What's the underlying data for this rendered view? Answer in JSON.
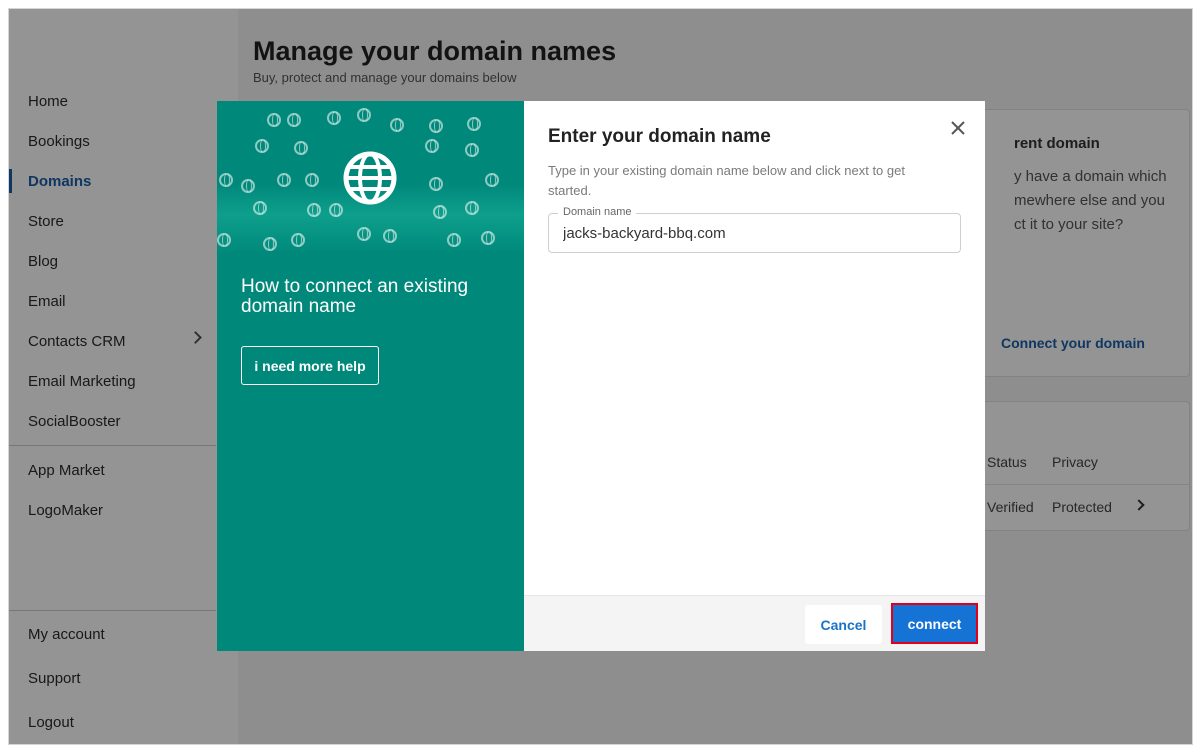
{
  "sidebar": {
    "items": [
      {
        "label": "Home"
      },
      {
        "label": "Bookings"
      },
      {
        "label": "Domains"
      },
      {
        "label": "Store"
      },
      {
        "label": "Blog"
      },
      {
        "label": "Email"
      },
      {
        "label": "Contacts CRM"
      },
      {
        "label": "Email Marketing"
      },
      {
        "label": "SocialBooster"
      },
      {
        "label": "App Market"
      },
      {
        "label": "LogoMaker"
      }
    ],
    "bottom_items": [
      {
        "label": "My account"
      },
      {
        "label": "Support"
      },
      {
        "label": "Logout"
      }
    ],
    "active": "Domains"
  },
  "main": {
    "title": "Manage your domain names",
    "subtitle": "Buy, protect and manage your domains below",
    "connect_card": {
      "title_fragment": "rent domain",
      "text_lines": [
        "y have a domain which",
        "mewhere else and you",
        "ct it to your site?"
      ],
      "link": "Connect your domain"
    },
    "domains_table": {
      "headers": [
        "Status",
        "Privacy"
      ],
      "row": [
        "Verified",
        "Protected"
      ]
    }
  },
  "modal": {
    "left": {
      "title": "How to connect an existing domain name",
      "help_button": "i need more help"
    },
    "title": "Enter your domain name",
    "description": "Type in your existing domain name below and click next to get started.",
    "field_label": "Domain name",
    "field_value": "jacks-backyard-bbq.com",
    "cancel_label": "Cancel",
    "connect_label": "connect"
  },
  "colors": {
    "teal": "#00897b",
    "primary": "#1673d6",
    "highlight": "#e1001a"
  }
}
